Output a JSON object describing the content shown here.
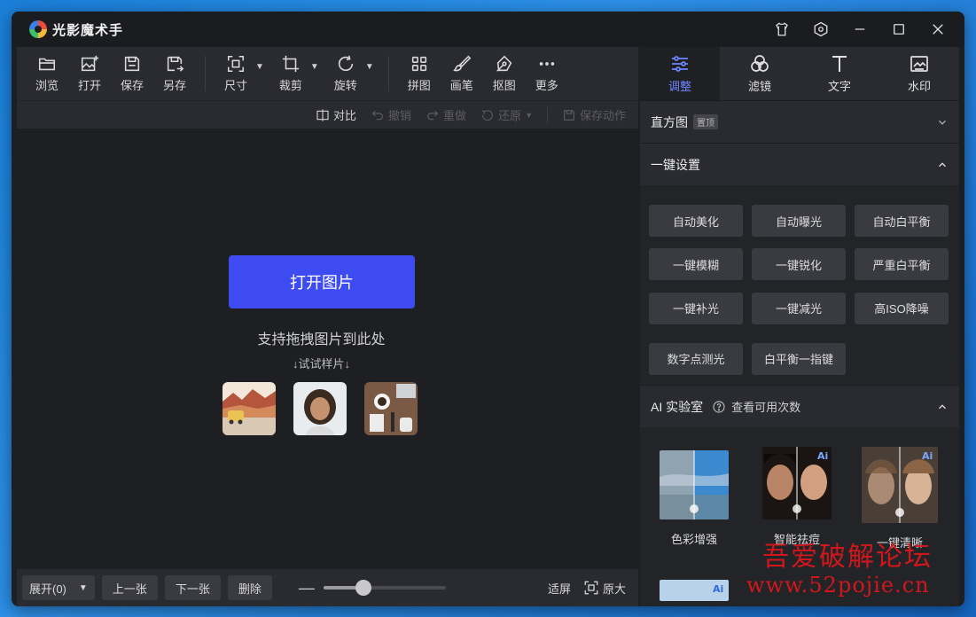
{
  "app": {
    "title": "光影魔术手"
  },
  "titlebar": {
    "icons": [
      "shirt-icon",
      "settings-hex-icon",
      "minimize-icon",
      "maximize-icon",
      "close-icon"
    ]
  },
  "toolbar": {
    "browse": "浏览",
    "open": "打开",
    "save": "保存",
    "save_as": "另存",
    "size": "尺寸",
    "crop": "裁剪",
    "rotate": "旋转",
    "collage": "拼图",
    "brush": "画笔",
    "cutout": "抠图",
    "more": "更多"
  },
  "subbar": {
    "compare": "对比",
    "undo": "撤销",
    "redo": "重做",
    "restore": "还原",
    "save_action": "保存动作"
  },
  "canvas": {
    "open_image": "打开图片",
    "drag_tip": "支持拖拽图片到此处",
    "sample_tip": "↓试试样片↓"
  },
  "bottombar": {
    "expand": "展开(0)",
    "prev": "上一张",
    "next": "下一张",
    "delete": "删除",
    "zoom_minus": "—",
    "zoom_level": 0.33,
    "fit": "适屏",
    "original": "原大"
  },
  "right_tabs": [
    {
      "label": "调整",
      "icon": "sliders-icon",
      "active": true
    },
    {
      "label": "滤镜",
      "icon": "filter-circles-icon",
      "active": false
    },
    {
      "label": "文字",
      "icon": "text-t-icon",
      "active": false
    },
    {
      "label": "水印",
      "icon": "watermark-icon",
      "active": false
    }
  ],
  "histogram": {
    "title": "直方图",
    "badge": "置顶"
  },
  "oneclick": {
    "title": "一键设置",
    "buttons": [
      "自动美化",
      "自动曝光",
      "自动白平衡",
      "一键模糊",
      "一键锐化",
      "严重白平衡",
      "一键补光",
      "一键减光",
      "高ISO降噪",
      "数字点测光",
      "白平衡一指键"
    ]
  },
  "ai_lab": {
    "title": "AI 实验室",
    "check_count": "查看可用次数",
    "cards": [
      {
        "name": "色彩增强"
      },
      {
        "name": "智能祛痘"
      },
      {
        "name": "一键清晰"
      }
    ]
  },
  "watermark": {
    "line1": "吾爱破解论坛",
    "line2": "www.52pojie.cn"
  },
  "colors": {
    "accent": "#3d4bf0",
    "active_tab": "#6e86ff",
    "bg": "#1e1f23",
    "panel": "#2a2b30"
  }
}
